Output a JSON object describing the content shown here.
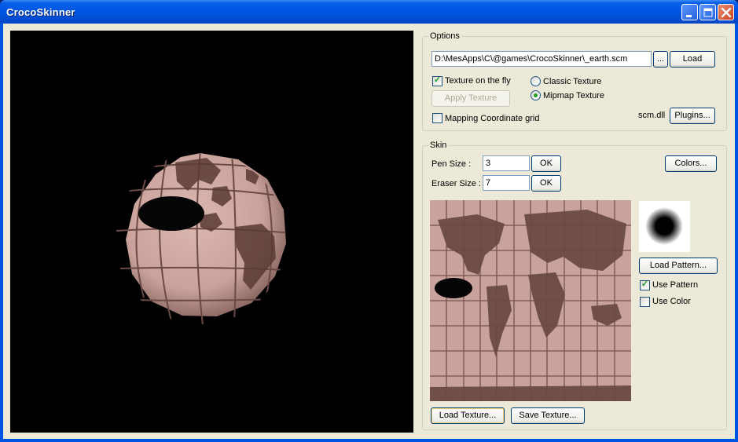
{
  "window": {
    "title": "CrocoSkinner"
  },
  "options": {
    "group_label": "Options",
    "file_path": "D:\\MesApps\\C\\@games\\CrocoSkinner\\_earth.scm",
    "browse_label": "...",
    "load_label": "Load",
    "texture_on_fly_label": "Texture on the fly",
    "texture_on_fly_checked": true,
    "apply_texture_label": "Apply Texture",
    "classic_texture_label": "Classic Texture",
    "mipmap_texture_label": "Mipmap Texture",
    "selected_texture_mode": "Mipmap Texture",
    "mapping_grid_label": "Mapping Coordinate grid",
    "mapping_grid_checked": false,
    "plugin_name": "scm.dll",
    "plugins_label": "Plugins..."
  },
  "skin": {
    "group_label": "Skin",
    "pen_size_label": "Pen Size :",
    "pen_size_value": "3",
    "eraser_size_label": "Eraser Size :",
    "eraser_size_value": "7",
    "ok_label": "OK",
    "colors_label": "Colors...",
    "load_pattern_label": "Load Pattern...",
    "use_pattern_label": "Use Pattern",
    "use_pattern_checked": true,
    "use_color_label": "Use Color",
    "use_color_checked": false,
    "load_texture_label": "Load Texture...",
    "save_texture_label": "Save Texture..."
  },
  "colors": {
    "skin_tone": "#c9a29b",
    "titlebar": "#0058e6",
    "dialog_bg": "#ece9d8"
  },
  "icons": [
    "minimize-icon",
    "maximize-icon",
    "close-icon",
    "checkmark-icon",
    "radio-dot-icon"
  ]
}
